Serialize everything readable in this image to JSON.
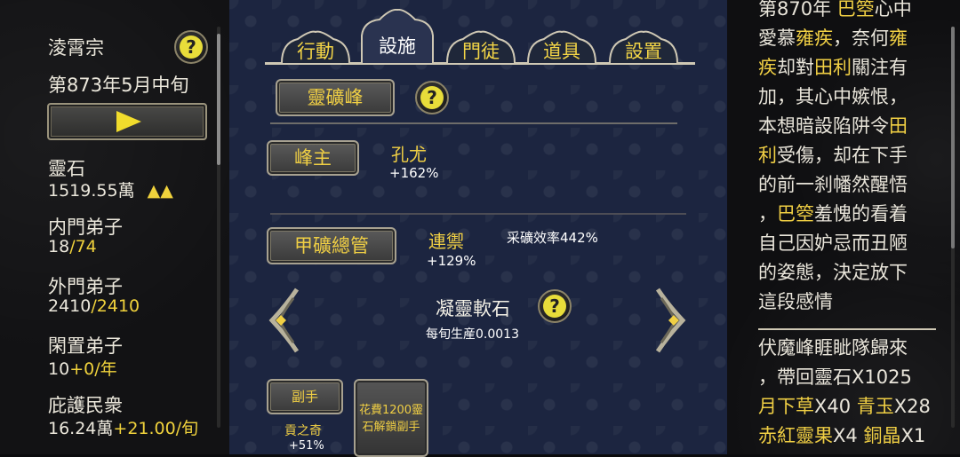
{
  "left": {
    "sect_name": "淩霄宗",
    "date": "第873年5月中旬",
    "stats": [
      {
        "label": "靈石",
        "value": "1519.55萬",
        "extra": "▲▲"
      },
      {
        "label": "内門弟子",
        "value": "18",
        "sep": "/",
        "max": "74"
      },
      {
        "label": "外門弟子",
        "value": "2410",
        "sep": "/",
        "max": "2410"
      },
      {
        "label": "閑置弟子",
        "value": "10",
        "delta": "+0/年"
      },
      {
        "label": "庇護民衆",
        "value": "16.24萬",
        "delta": "+21.00/旬"
      }
    ]
  },
  "tabs": [
    {
      "label": "行動",
      "active": false
    },
    {
      "label": "設施",
      "active": true
    },
    {
      "label": "門徒",
      "active": false
    },
    {
      "label": "道具",
      "active": false
    },
    {
      "label": "設置",
      "active": false
    }
  ],
  "facility": {
    "name": "靈礦峰",
    "leader_title": "峰主",
    "leader_name": "孔尤",
    "leader_bonus": "+162%",
    "manager_title": "甲礦總管",
    "manager_name": "連禦",
    "manager_bonus": "+129%",
    "efficiency": "采礦效率442%",
    "product_name": "凝靈軟石",
    "production": "每旬生産0.0013",
    "deputy_label": "副手",
    "deputy_name": "貢之奇",
    "deputy_bonus": "+51%",
    "unlock_text_1": "花費1200靈",
    "unlock_text_2": "石解鎖副手"
  },
  "log": {
    "lines1": [
      [
        {
          "t": "第870年 "
        },
        {
          "t": "巴箜",
          "h": true
        },
        {
          "t": "心中"
        }
      ],
      [
        {
          "t": "愛慕"
        },
        {
          "t": "雍疾",
          "h": true
        },
        {
          "t": "，奈何"
        },
        {
          "t": "雍",
          "h": true
        }
      ],
      [
        {
          "t": "疾",
          "h": true
        },
        {
          "t": "却對"
        },
        {
          "t": "田利",
          "h": true
        },
        {
          "t": "關注有"
        }
      ],
      [
        {
          "t": "加，其心中嫉恨，"
        }
      ],
      [
        {
          "t": "本想暗設陷阱令"
        },
        {
          "t": "田",
          "h": true
        }
      ],
      [
        {
          "t": "利",
          "h": true
        },
        {
          "t": "受傷，却在下手"
        }
      ],
      [
        {
          "t": "的前一刹幡然醒悟"
        }
      ],
      [
        {
          "t": "，"
        },
        {
          "t": "巴箜",
          "h": true
        },
        {
          "t": "羞愧的看着"
        }
      ],
      [
        {
          "t": "自己因妒忌而丑陋"
        }
      ],
      [
        {
          "t": "的姿態，決定放下"
        }
      ],
      [
        {
          "t": "這段感情"
        }
      ]
    ],
    "lines2": [
      [
        {
          "t": "伏魔峰睚眦隊歸來"
        }
      ],
      [
        {
          "t": "，帶回靈石X1025"
        }
      ],
      [
        {
          "t": "月下草",
          "h": true
        },
        {
          "t": "X40 "
        },
        {
          "t": "青玉",
          "h": true
        },
        {
          "t": "X28"
        }
      ],
      [
        {
          "t": "赤紅靈果",
          "h": true
        },
        {
          "t": "X4 "
        },
        {
          "t": "銅晶",
          "h": true
        },
        {
          "t": "X1"
        }
      ]
    ]
  },
  "colors": {
    "accent": "#f0cf44",
    "highlight": "#f0d23c",
    "panel_center": "#1c2540"
  },
  "icons": [
    "help-icon",
    "play-icon",
    "arrow-left-icon",
    "arrow-right-icon"
  ]
}
